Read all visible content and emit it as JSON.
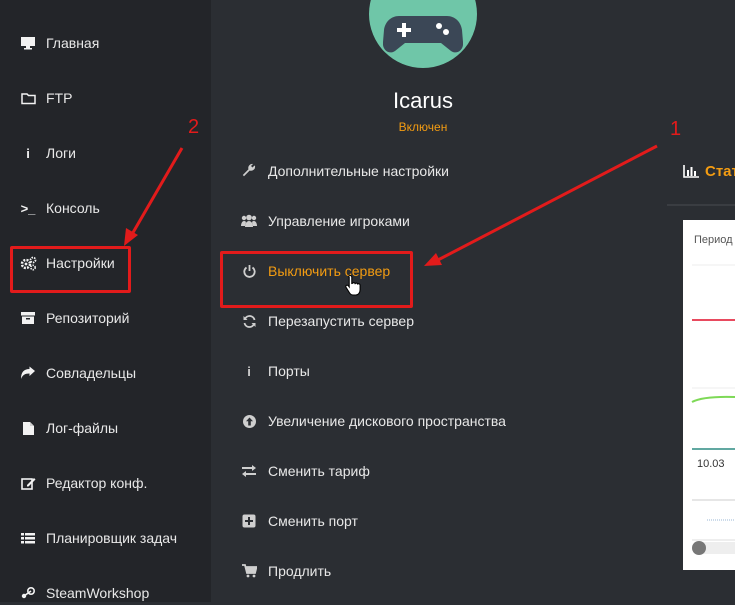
{
  "sidebar": {
    "items": [
      {
        "label": "Главная",
        "icon": "monitor-icon"
      },
      {
        "label": "FTP",
        "icon": "folder-icon"
      },
      {
        "label": "Логи",
        "icon": "info-icon"
      },
      {
        "label": "Консоль",
        "icon": "terminal-icon"
      },
      {
        "label": "Настройки",
        "icon": "gears-icon"
      },
      {
        "label": "Репозиторий",
        "icon": "archive-icon"
      },
      {
        "label": "Совладельцы",
        "icon": "share-icon"
      },
      {
        "label": "Лог-файлы",
        "icon": "file-icon"
      },
      {
        "label": "Редактор конф.",
        "icon": "edit-icon"
      },
      {
        "label": "Планировщик задач",
        "icon": "list-icon"
      },
      {
        "label": "SteamWorkshop",
        "icon": "steam-icon"
      }
    ]
  },
  "server": {
    "name": "Icarus",
    "status": "Включен",
    "avatar_icon": "gamepad-icon"
  },
  "menu": {
    "items": [
      {
        "label": "Дополнительные настройки",
        "icon": "wrench-icon"
      },
      {
        "label": "Управление игроками",
        "icon": "users-icon"
      },
      {
        "label": "Выключить сервер",
        "icon": "power-icon"
      },
      {
        "label": "Перезапустить сервер",
        "icon": "refresh-icon"
      },
      {
        "label": "Порты",
        "icon": "info-icon"
      },
      {
        "label": "Увеличение дискового пространства",
        "icon": "arrow-up-circle-icon"
      },
      {
        "label": "Сменить тариф",
        "icon": "exchange-icon"
      },
      {
        "label": "Сменить порт",
        "icon": "plus-square-icon"
      },
      {
        "label": "Продлить",
        "icon": "cart-icon"
      }
    ]
  },
  "stats": {
    "title": "Стат",
    "period": "Период",
    "date_tick": "10.03",
    "icon": "bar-chart-icon"
  },
  "annotations": {
    "label_1": "1",
    "label_2": "2"
  },
  "colors": {
    "accent": "#f39c12",
    "annotation": "#e21b1b",
    "avatar_bg": "#6fc6a8",
    "sidebar_bg": "#232529",
    "main_bg": "#2b2e33"
  }
}
